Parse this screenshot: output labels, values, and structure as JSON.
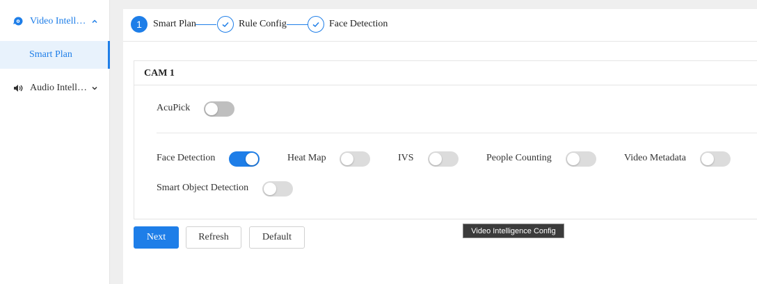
{
  "sidebar": {
    "groups": [
      {
        "label": "Video Intell…",
        "icon": "video-ai-icon",
        "expanded": true
      },
      {
        "label": "Audio Intell…",
        "icon": "speaker-icon",
        "expanded": false
      }
    ],
    "active_item": {
      "label": "Smart Plan"
    }
  },
  "steps": [
    {
      "number": "1",
      "label": "Smart Plan",
      "state": "active"
    },
    {
      "label": "Rule Config",
      "state": "done"
    },
    {
      "label": "Face Detection",
      "state": "done"
    }
  ],
  "card": {
    "title": "CAM 1",
    "acupick": {
      "label": "AcuPick",
      "on": false
    },
    "features": [
      {
        "label": "Face Detection",
        "on": true
      },
      {
        "label": "Heat Map",
        "on": false
      },
      {
        "label": "IVS",
        "on": false
      },
      {
        "label": "People Counting",
        "on": false
      },
      {
        "label": "Video Metadata",
        "on": false
      },
      {
        "label": "Smart Object Detection",
        "on": false
      }
    ]
  },
  "buttons": {
    "next": "Next",
    "refresh": "Refresh",
    "default": "Default"
  },
  "tooltip": "Video Intelligence Config",
  "colors": {
    "accent": "#1e7ee8",
    "toggle_off": "#dcdcdc",
    "sidebar_active_bg": "#e8f2fc"
  }
}
